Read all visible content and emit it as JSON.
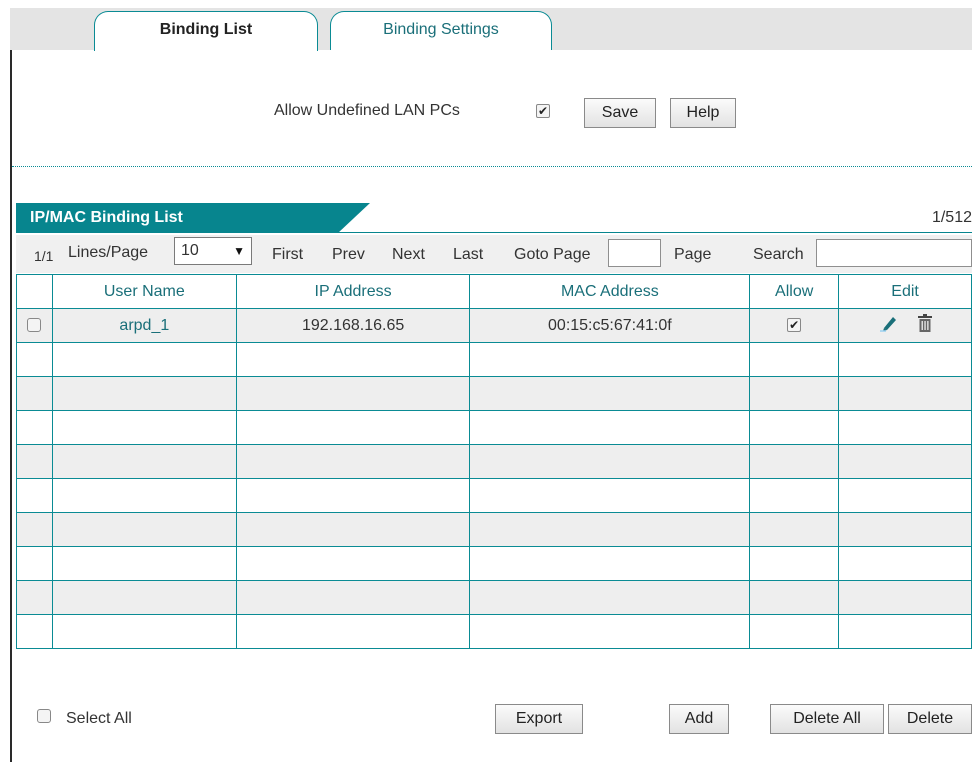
{
  "tabs": [
    {
      "label": "Binding List",
      "active": true
    },
    {
      "label": "Binding Settings",
      "active": false
    }
  ],
  "allow_undefined": {
    "label": "Allow Undefined LAN PCs",
    "checked": true
  },
  "buttons": {
    "save": "Save",
    "help": "Help",
    "export": "Export",
    "add": "Add",
    "delete_all": "Delete All",
    "delete": "Delete"
  },
  "list": {
    "title": "IP/MAC Binding List",
    "count": "1/512",
    "pager": {
      "page_indicator": "1/1",
      "lines_label": "Lines/Page",
      "lines_value": "10",
      "first": "First",
      "prev": "Prev",
      "next": "Next",
      "last": "Last",
      "goto_label": "Goto Page",
      "goto_value": "",
      "page_label": "Page",
      "search_label": "Search",
      "search_value": ""
    },
    "columns": [
      "",
      "User Name",
      "IP Address",
      "MAC Address",
      "Allow",
      "Edit"
    ],
    "rows": [
      {
        "user": "arpd_1",
        "ip": "192.168.16.65",
        "mac": "00:15:c5:67:41:0f",
        "allow": true
      }
    ],
    "empty_rows": 9
  },
  "footer": {
    "select_all": "Select All"
  },
  "colors": {
    "accent": "#07858e",
    "link": "#1a6f79",
    "row_alt": "#eeeeee"
  },
  "icons": {
    "allow_check": "✔",
    "edit": "pencil-icon",
    "delete": "trash-icon"
  }
}
